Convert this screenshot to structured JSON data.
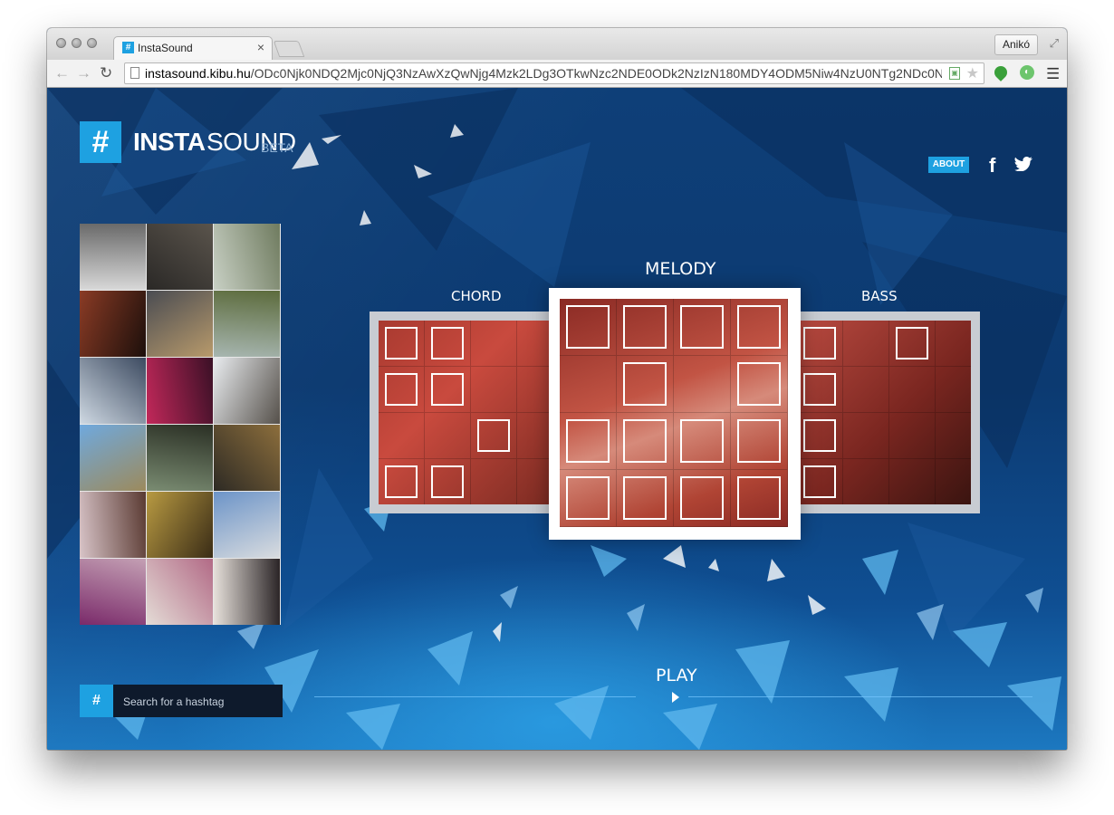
{
  "browser": {
    "tab_title": "InstaSound",
    "tab_favicon": "#",
    "tab_close": "×",
    "profile_name": "Anikó",
    "url_host": "instasound.kibu.hu",
    "url_path": "/ODc0Njk0NDQ2Mjc0NjQ3NzAwXzQwNjg4Mzk2LDg3OTkwNzc2NDE0ODk2NzIzN180MDY4ODM5Niw4NzU0NTg2NDc0N..."
  },
  "header": {
    "logo_icon": "#",
    "logo_insta": "INSTA",
    "logo_sound": "SOUND",
    "logo_beta": "BETA",
    "about_label": "ABOUT",
    "facebook_icon": "f"
  },
  "pads": {
    "chord_label": "CHORD",
    "melody_label": "MELODY",
    "bass_label": "BASS",
    "chord_active": [
      [
        1,
        1,
        0,
        0
      ],
      [
        1,
        1,
        0,
        0
      ],
      [
        0,
        0,
        1,
        0
      ],
      [
        1,
        1,
        0,
        0
      ]
    ],
    "melody_active": [
      [
        1,
        1,
        1,
        1
      ],
      [
        0,
        1,
        0,
        1
      ],
      [
        1,
        1,
        1,
        1
      ],
      [
        1,
        1,
        1,
        1
      ]
    ],
    "bass_active": [
      [
        1,
        0,
        1,
        0
      ],
      [
        1,
        0,
        0,
        0
      ],
      [
        1,
        0,
        0,
        0
      ],
      [
        1,
        0,
        0,
        0
      ]
    ]
  },
  "player": {
    "play_label": "PLAY"
  },
  "search": {
    "hash_icon": "#",
    "placeholder": "Search for a hashtag"
  },
  "photos": [
    {
      "c1": "#d8d8d8",
      "c2": "#6a6a6a"
    },
    {
      "c1": "#2a2826",
      "c2": "#5a544c"
    },
    {
      "c1": "#c8d0c4",
      "c2": "#6f7b5f"
    },
    {
      "c1": "#8a3b25",
      "c2": "#1c0f0b"
    },
    {
      "c1": "#4a4c52",
      "c2": "#b89a6b"
    },
    {
      "c1": "#a7b6b0",
      "c2": "#5c6b3c"
    },
    {
      "c1": "#cfd9e3",
      "c2": "#3c4a60"
    },
    {
      "c1": "#c2285a",
      "c2": "#3a1026"
    },
    {
      "c1": "#e9ecef",
      "c2": "#55504a"
    },
    {
      "c1": "#6fa9de",
      "c2": "#9c8a5c"
    },
    {
      "c1": "#7a8c72",
      "c2": "#2a2f24"
    },
    {
      "c1": "#2d2a24",
      "c2": "#8c6e3c"
    },
    {
      "c1": "#d8c4c8",
      "c2": "#5a3a32"
    },
    {
      "c1": "#b89a42",
      "c2": "#3a2c16"
    },
    {
      "c1": "#6c94c8",
      "c2": "#d9dcdf"
    },
    {
      "c1": "#7a2a6a",
      "c2": "#c4a0b4"
    },
    {
      "c1": "#e4dcd6",
      "c2": "#b26a86"
    },
    {
      "c1": "#e8e2dc",
      "c2": "#2a2426"
    }
  ]
}
